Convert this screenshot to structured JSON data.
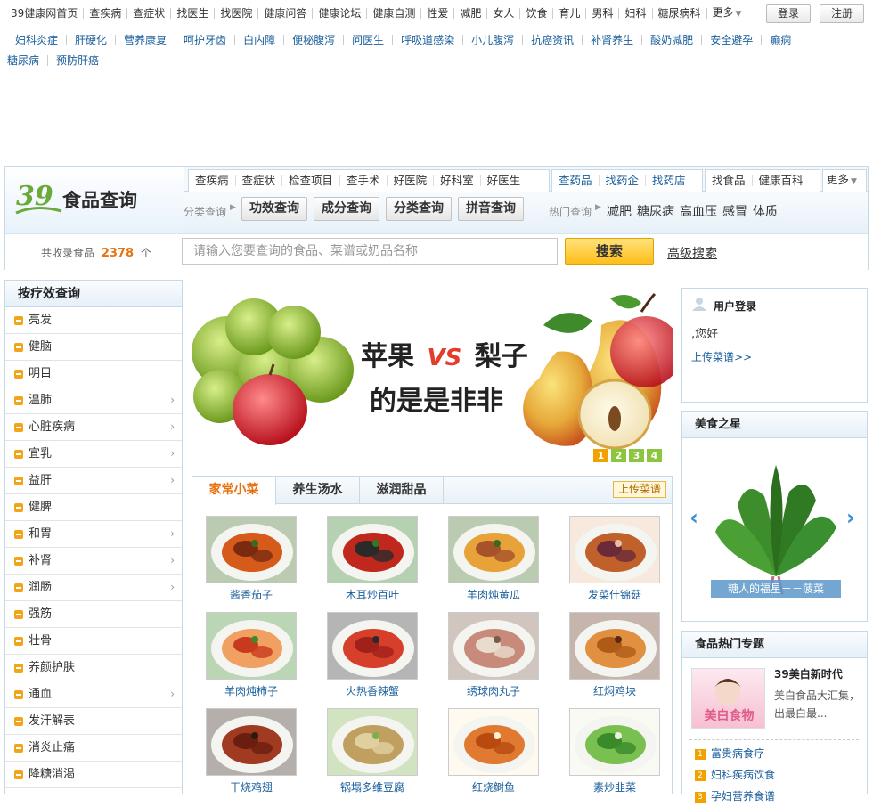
{
  "top_nav": [
    "39健康网首页",
    "查疾病",
    "查症状",
    "找医生",
    "找医院",
    "健康问答",
    "健康论坛",
    "健康自测",
    "性爱",
    "减肥",
    "女人",
    "饮食",
    "育儿",
    "男科",
    "妇科",
    "糖尿病科",
    "更多"
  ],
  "auth": {
    "login": "登录",
    "register": "注册"
  },
  "tags_row1": [
    "妇科炎症",
    "肝硬化",
    "营养康复",
    "呵护牙齿",
    "白内障",
    "便秘腹泻",
    "问医生",
    "呼吸道感染",
    "小儿腹泻",
    "抗癌资讯",
    "补肾养生",
    "酸奶减肥",
    "安全避孕",
    "癫痫"
  ],
  "tags_row2": [
    "糖尿病",
    "预防肝癌"
  ],
  "header": {
    "logo_number": "39",
    "logo_title": "食品查询",
    "nav_group1": [
      "查疾病",
      "查症状",
      "检查项目",
      "查手术",
      "好医院",
      "好科室",
      "好医生"
    ],
    "nav_group2": [
      "查药品",
      "找药企",
      "找药店"
    ],
    "nav_group3": [
      "找食品",
      "健康百科"
    ],
    "nav_more": "更多",
    "category_label": "分类查询",
    "category_buttons": [
      "功效查询",
      "成分查询",
      "分类查询",
      "拼音查询"
    ],
    "hot_label": "热门查询",
    "hot_items": [
      "减肥",
      "糖尿病",
      "高血压",
      "感冒",
      "体质"
    ],
    "count_prefix": "共收录食品",
    "count_value": "2378",
    "count_suffix": "个",
    "search_placeholder": "请输入您要查询的食品、菜谱或奶品名称",
    "search_button": "搜索",
    "advanced_search": "高级搜索"
  },
  "sidebar": {
    "title": "按疗效查询",
    "items": [
      {
        "label": "亮发",
        "arrow": ""
      },
      {
        "label": "健脑",
        "arrow": ""
      },
      {
        "label": "明目",
        "arrow": ""
      },
      {
        "label": "温肺",
        "arrow": "›"
      },
      {
        "label": "心脏疾病",
        "arrow": "›"
      },
      {
        "label": "宜乳",
        "arrow": "›"
      },
      {
        "label": "益肝",
        "arrow": "›"
      },
      {
        "label": "健脾",
        "arrow": ""
      },
      {
        "label": "和胃",
        "arrow": "›"
      },
      {
        "label": "补肾",
        "arrow": "›"
      },
      {
        "label": "润肠",
        "arrow": "›"
      },
      {
        "label": "强筋",
        "arrow": ""
      },
      {
        "label": "壮骨",
        "arrow": ""
      },
      {
        "label": "养颜护肤",
        "arrow": ""
      },
      {
        "label": "通血",
        "arrow": "›"
      },
      {
        "label": "发汗解表",
        "arrow": ""
      },
      {
        "label": "消炎止痛",
        "arrow": ""
      },
      {
        "label": "降糖消渴",
        "arrow": ""
      }
    ]
  },
  "banner": {
    "line1_left": "苹果",
    "vs": "VS",
    "line1_right": "梨子",
    "line2": "的是是非非",
    "pages": [
      "1",
      "2",
      "3",
      "4"
    ]
  },
  "recipes": {
    "tabs": [
      "家常小菜",
      "养生汤水",
      "滋润甜品"
    ],
    "upload_button": "上传菜谱",
    "dishes": [
      "酱香茄子",
      "木耳炒百叶",
      "羊肉炖黄瓜",
      "发菜什锦菇",
      "羊肉炖柿子",
      "火热香辣蟹",
      "绣球肉丸子",
      "红焖鸡块",
      "干烧鸡翅",
      "锅塌多维豆腐",
      "红烧鲥鱼",
      "素炒韭菜"
    ]
  },
  "user_login": {
    "title": "用户登录",
    "greeting": ",您好",
    "upload_link": "上传菜谱>>"
  },
  "food_star": {
    "title": "美食之星",
    "caption": "糖人的福星－－菠菜"
  },
  "hot_topics": {
    "title": "食品热门专题",
    "feature_title": "39美白新时代",
    "feature_desc": "美白食品大汇集，出最白最...",
    "feature_image_text": "美白食物",
    "list": [
      {
        "rank": "1",
        "text": "富贵病食疗"
      },
      {
        "rank": "2",
        "text": "妇科疾病饮食"
      },
      {
        "rank": "3",
        "text": "孕妇营养食谱"
      }
    ]
  }
}
